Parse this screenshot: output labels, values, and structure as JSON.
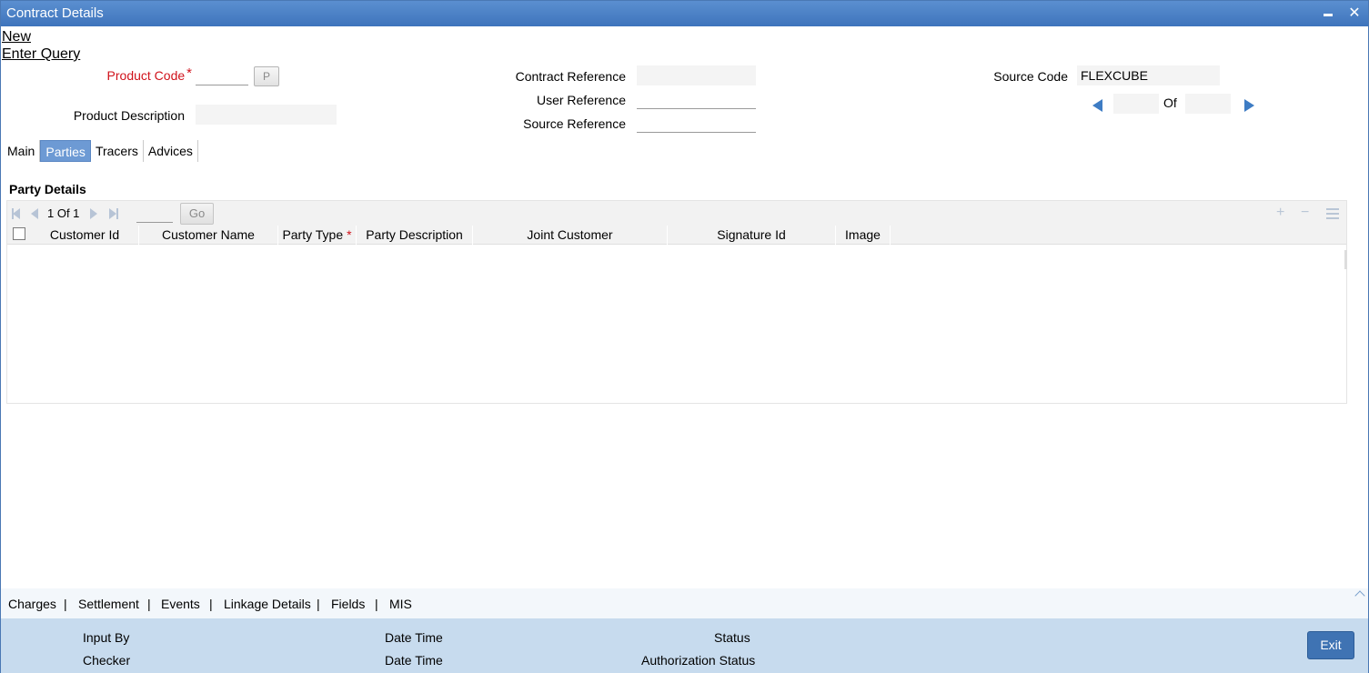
{
  "window": {
    "title": "Contract Details"
  },
  "actions": {
    "new": "New",
    "enter_query": "Enter Query"
  },
  "form": {
    "product_code_label": "Product Code",
    "product_code_value": "",
    "product_lov_button": "P",
    "product_description_label": "Product Description",
    "product_description_value": "",
    "contract_reference_label": "Contract Reference",
    "contract_reference_value": "",
    "user_reference_label": "User Reference",
    "user_reference_value": "",
    "source_reference_label": "Source Reference",
    "source_reference_value": "",
    "source_code_label": "Source Code",
    "source_code_value": "FLEXCUBE",
    "record_nav": {
      "current": "",
      "of_label": "Of",
      "total": ""
    }
  },
  "tabs": [
    {
      "label": "Main",
      "active": false
    },
    {
      "label": "Parties",
      "active": true
    },
    {
      "label": "Tracers",
      "active": false
    },
    {
      "label": "Advices",
      "active": false
    }
  ],
  "party_details": {
    "title": "Party Details",
    "pager_text": "1 Of 1",
    "go_label": "Go",
    "columns": [
      {
        "label": "Customer Id"
      },
      {
        "label": "Customer Name"
      },
      {
        "label": "Party Type",
        "required": true
      },
      {
        "label": "Party Description"
      },
      {
        "label": "Joint Customer"
      },
      {
        "label": "Signature Id"
      },
      {
        "label": "Image"
      }
    ],
    "rows": []
  },
  "bottom_links": [
    "Charges",
    "Settlement",
    "Events",
    "Linkage Details",
    "Fields",
    "MIS"
  ],
  "audit": {
    "input_by": "Input By",
    "date_time_1": "Date Time",
    "status": "Status",
    "checker": "Checker",
    "date_time_2": "Date Time",
    "authorization_status": "Authorization Status",
    "exit_label": "Exit"
  },
  "colors": {
    "titlebar": "#3e74bc",
    "active_tab": "#6d9ad4",
    "required": "#d0121b",
    "audit_bg": "#c7dbee",
    "exit_button": "#3f73b3"
  }
}
